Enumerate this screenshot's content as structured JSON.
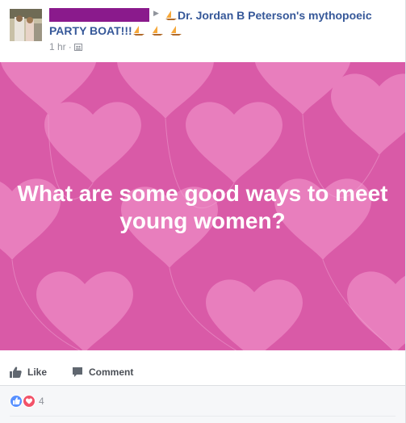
{
  "post": {
    "author_name": "",
    "group_name_line1": "Dr. Jordan B Peterson's mythopoeic",
    "group_name_line2": "PARTY BOAT!!!",
    "time": "1 hr",
    "audience_icon": "group-icon",
    "boat_icon": "sailboat-emoji"
  },
  "image": {
    "text": "What are some good ways to meet young women?",
    "background_color": "#d95aa7",
    "heart_color": "#ef8ac6"
  },
  "actions": {
    "like_label": "Like",
    "comment_label": "Comment"
  },
  "reactions": {
    "count": "4",
    "types": [
      "like",
      "love"
    ]
  },
  "colors": {
    "link": "#365899",
    "like_blue": "#5890ff",
    "love_red": "#f25268"
  }
}
